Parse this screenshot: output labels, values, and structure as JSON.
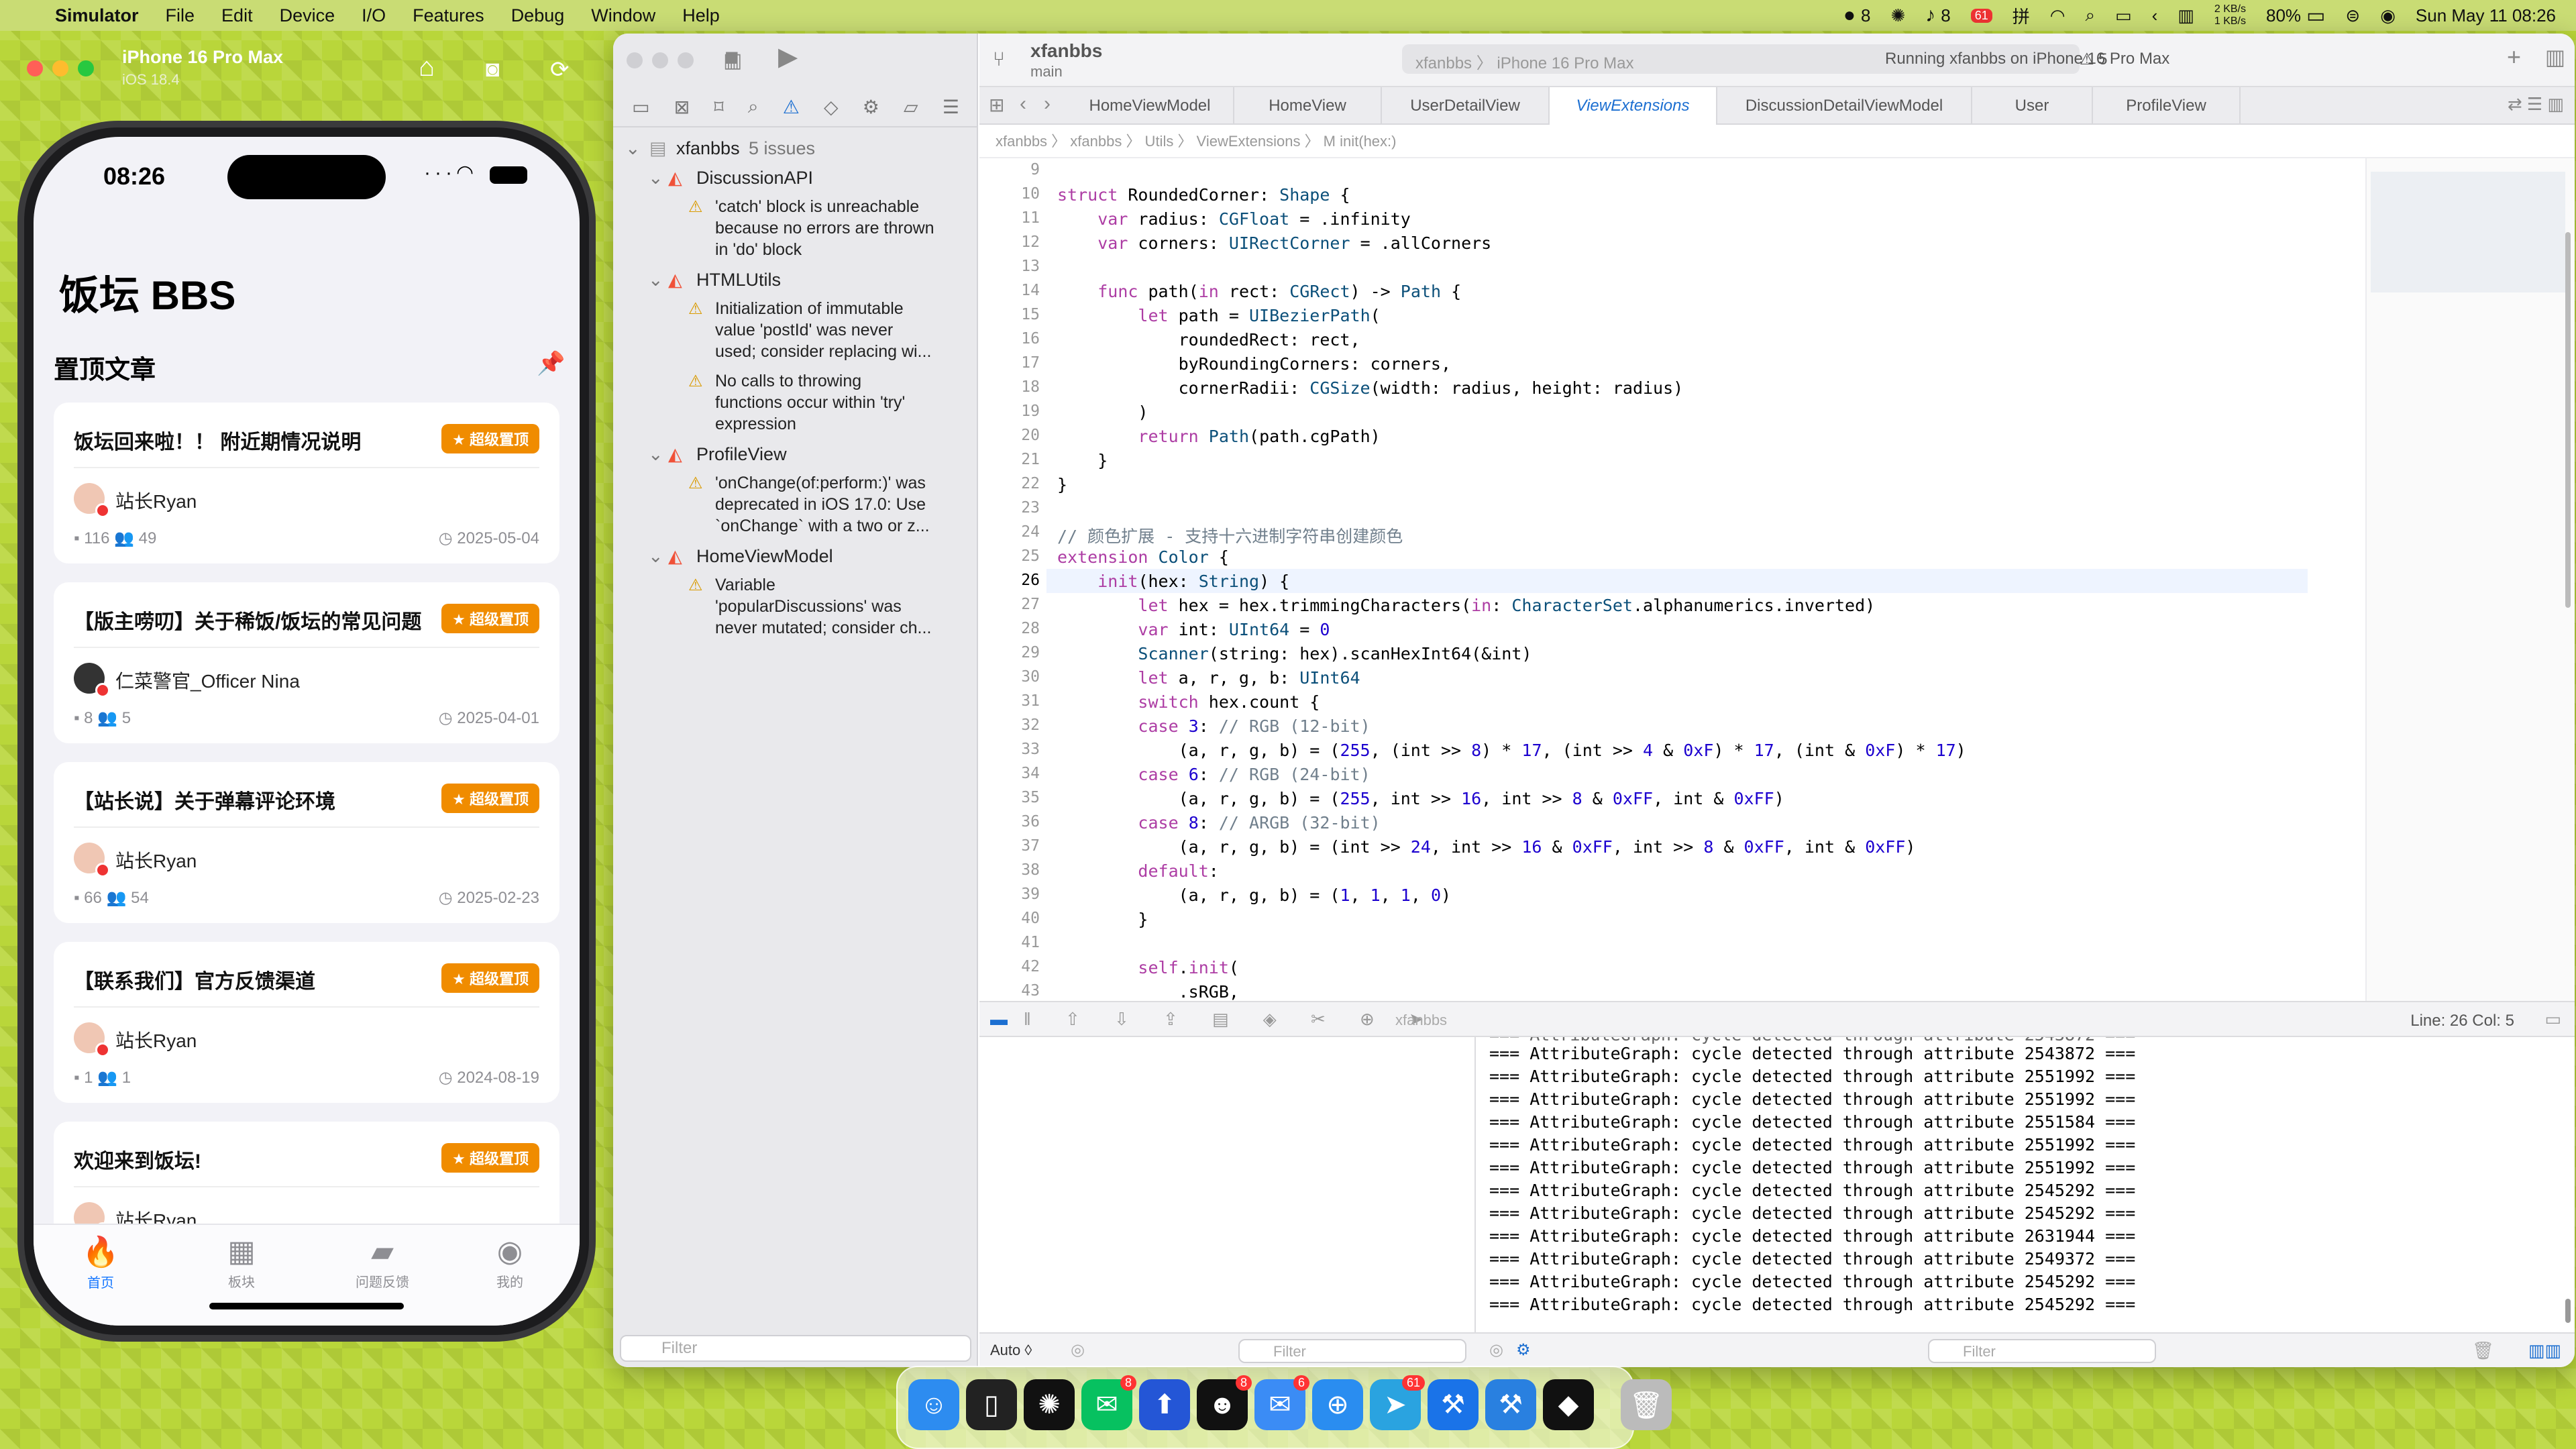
{
  "menubar": {
    "apple": "",
    "items": [
      "Simulator",
      "File",
      "Edit",
      "Device",
      "I/O",
      "Features",
      "Debug",
      "Window",
      "Help"
    ],
    "wechat_count": "8",
    "notif_count": "8",
    "badge_red": "61",
    "net_up": "2 KB/s",
    "net_down": "1 KB/s",
    "battery": "80%",
    "datetime": "Sun May 11  08:26"
  },
  "simulator": {
    "device": "iPhone 16 Pro Max",
    "os": "iOS 18.4",
    "phone_time": "08:26",
    "app_title": "饭坛 BBS",
    "pinned_title": "置顶文章",
    "badge_label": "超级置顶",
    "cards": [
      {
        "title": "饭坛回来啦！！ 附近期情况说明",
        "author": "站长Ryan",
        "comments": "116",
        "users": "49",
        "date": "2025-05-04"
      },
      {
        "title": "【版主唠叨】关于稀饭/饭坛的常见问题",
        "author": "仁菜警官_Officer Nina",
        "comments": "8",
        "users": "5",
        "date": "2025-04-01"
      },
      {
        "title": "【站长说】关于弹幕评论环境",
        "author": "站长Ryan",
        "comments": "66",
        "users": "54",
        "date": "2025-02-23"
      },
      {
        "title": "【联系我们】官方反馈渠道",
        "author": "站长Ryan",
        "comments": "1",
        "users": "1",
        "date": "2024-08-19"
      },
      {
        "title": "欢迎来到饭坛!",
        "author": "站长Ryan",
        "comments": "",
        "users": "",
        "date": ""
      }
    ],
    "tabs": [
      "首页",
      "板块",
      "问题反馈",
      "我的"
    ]
  },
  "xcode": {
    "project": "xfanbbs",
    "branch": "main",
    "scheme": "xfanbbs  〉  iPhone 16 Pro Max",
    "status": "Running xfanbbs on iPhone 16 Pro Max",
    "warnings": "⚠ 5",
    "navigator": {
      "root": "xfanbbs",
      "root_issues": "5 issues",
      "groups": [
        {
          "name": "DiscussionAPI",
          "issues": [
            "'catch' block is unreachable",
            "because no errors are thrown",
            "in 'do' block"
          ]
        },
        {
          "name": "HTMLUtils",
          "issues": [
            "Initialization of immutable",
            "value 'postId' was never",
            "used; consider replacing wi...",
            "No calls to throwing",
            "functions occur within 'try'",
            "expression"
          ]
        },
        {
          "name": "ProfileView",
          "issues": [
            "'onChange(of:perform:)' was",
            "deprecated in iOS 17.0: Use",
            "`onChange` with a two or z..."
          ]
        },
        {
          "name": "HomeViewModel",
          "issues": [
            "Variable",
            "'popularDiscussions' was",
            "never mutated; consider ch..."
          ]
        }
      ],
      "filter_placeholder": "Filter"
    },
    "tabs": [
      "HomeViewModel",
      "HomeView",
      "UserDetailView",
      "ViewExtensions",
      "DiscussionDetailViewModel",
      "User",
      "ProfileView"
    ],
    "jumpbar": "xfanbbs  〉  xfanbbs  〉  Utils  〉  ViewExtensions  〉  M  init(hex:)",
    "line_numbers": [
      "9",
      "10",
      "11",
      "12",
      "13",
      "14",
      "15",
      "16",
      "17",
      "18",
      "19",
      "20",
      "21",
      "22",
      "23",
      "24",
      "25",
      "26",
      "27",
      "28",
      "29",
      "30",
      "31",
      "32",
      "33",
      "34",
      "35",
      "36",
      "37",
      "38",
      "39",
      "40",
      "41",
      "42",
      "43"
    ],
    "code_lines": [
      "",
      "struct RoundedCorner: Shape {",
      "    var radius: CGFloat = .infinity",
      "    var corners: UIRectCorner = .allCorners",
      "",
      "    func path(in rect: CGRect) -> Path {",
      "        let path = UIBezierPath(",
      "            roundedRect: rect,",
      "            byRoundingCorners: corners,",
      "            cornerRadii: CGSize(width: radius, height: radius)",
      "        )",
      "        return Path(path.cgPath)",
      "    }",
      "}",
      "",
      "// 颜色扩展 - 支持十六进制字符串创建颜色",
      "extension Color {",
      "    init(hex: String) {",
      "        let hex = hex.trimmingCharacters(in: CharacterSet.alphanumerics.inverted)",
      "        var int: UInt64 = 0",
      "        Scanner(string: hex).scanHexInt64(&int)",
      "        let a, r, g, b: UInt64",
      "        switch hex.count {",
      "        case 3: // RGB (12-bit)",
      "            (a, r, g, b) = (255, (int >> 8) * 17, (int >> 4 & 0xF) * 17, (int & 0xF) * 17)",
      "        case 6: // RGB (24-bit)",
      "            (a, r, g, b) = (255, int >> 16, int >> 8 & 0xFF, int & 0xFF)",
      "        case 8: // ARGB (32-bit)",
      "            (a, r, g, b) = (int >> 24, int >> 16 & 0xFF, int >> 8 & 0xFF, int & 0xFF)",
      "        default:",
      "            (a, r, g, b) = (1, 1, 1, 0)",
      "        }",
      "",
      "        self.init(",
      "            .sRGB,"
    ],
    "current_line_index": 17,
    "cursor": "Line: 26  Col: 5",
    "debug_target": "xfanbbs",
    "console_lines": [
      "=== AttributeGraph: cycle detected through attribute 2543872 ===",
      "=== AttributeGraph: cycle detected through attribute 2551992 ===",
      "=== AttributeGraph: cycle detected through attribute 2551992 ===",
      "=== AttributeGraph: cycle detected through attribute 2551584 ===",
      "=== AttributeGraph: cycle detected through attribute 2551992 ===",
      "=== AttributeGraph: cycle detected through attribute 2551992 ===",
      "=== AttributeGraph: cycle detected through attribute 2545292 ===",
      "=== AttributeGraph: cycle detected through attribute 2545292 ===",
      "=== AttributeGraph: cycle detected through attribute 2631944 ===",
      "=== AttributeGraph: cycle detected through attribute 2549372 ===",
      "=== AttributeGraph: cycle detected through attribute 2545292 ===",
      "=== AttributeGraph: cycle detected through attribute 2545292 ==="
    ],
    "var_mode": "Auto ◊",
    "filter_placeholder": "Filter"
  },
  "dock": {
    "apps": [
      {
        "name": "finder-app",
        "color": "#2d8cf0",
        "glyph": "☺",
        "badge": ""
      },
      {
        "name": "iphone-mirroring-app",
        "color": "#222",
        "glyph": "▯",
        "badge": ""
      },
      {
        "name": "chatgpt-app",
        "color": "#111",
        "glyph": "✺",
        "badge": ""
      },
      {
        "name": "wechat-app",
        "color": "#07c160",
        "glyph": "✉",
        "badge": "8"
      },
      {
        "name": "upload-app",
        "color": "#2456d6",
        "glyph": "⬆",
        "badge": ""
      },
      {
        "name": "qq-app",
        "color": "#111",
        "glyph": "☻",
        "badge": "8"
      },
      {
        "name": "mail-app",
        "color": "#3b8cf5",
        "glyph": "✉",
        "badge": "6"
      },
      {
        "name": "safari-app",
        "color": "#2a8df0",
        "glyph": "⊕",
        "badge": ""
      },
      {
        "name": "telegram-app",
        "color": "#2aa3e0",
        "glyph": "➤",
        "badge": "61"
      },
      {
        "name": "xcode-app",
        "color": "#1a73e8",
        "glyph": "⚒",
        "badge": ""
      },
      {
        "name": "simulator-app",
        "color": "#2980e0",
        "glyph": "⚒",
        "badge": ""
      },
      {
        "name": "cube-app",
        "color": "#111",
        "glyph": "◆",
        "badge": ""
      },
      {
        "name": "trash-app",
        "color": "#bbb",
        "glyph": "🗑",
        "badge": ""
      }
    ]
  },
  "colors": {
    "accent": "#1677ff",
    "badge": "#f08c00",
    "warning": "#d99a00"
  }
}
